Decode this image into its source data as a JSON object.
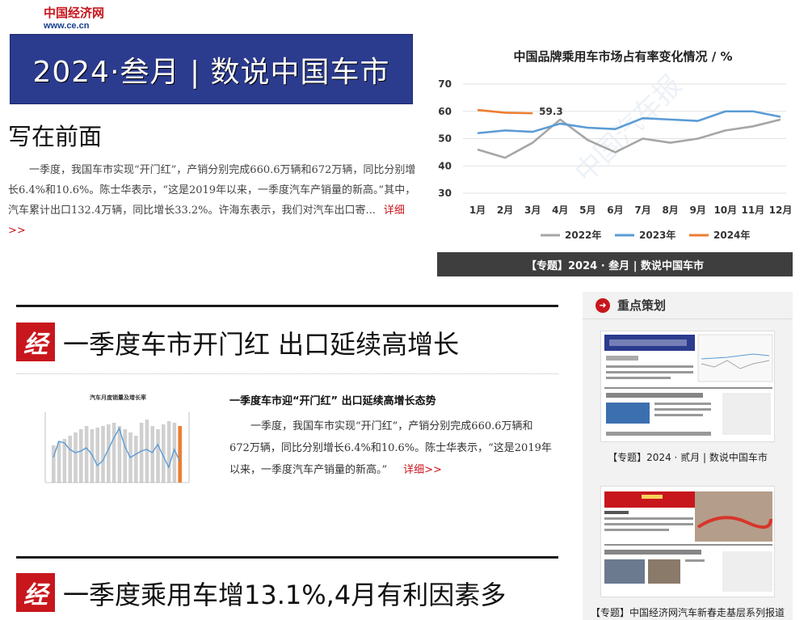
{
  "logo": {
    "cn": "中国经济网",
    "en": "www.ce.cn"
  },
  "banner": {
    "text": "2024·叁月 | 数说中国车市"
  },
  "intro": {
    "heading": "写在前面",
    "body": "一季度，我国车市实现“开门红”，产销分别完成660.6万辆和672万辆，同比分别增长6.4%和10.6%。陈士华表示，“这是2019年以来，一季度汽车产销量的新高。”其中，汽车累计出口132.4万辆，同比增长33.2%。许海东表示，我们对汽车出口寄...",
    "more": "详细>>"
  },
  "chart_data": {
    "type": "line",
    "title": "中国品牌乘用车市场占有率变化情况 / %",
    "categories": [
      "1月",
      "2月",
      "3月",
      "4月",
      "5月",
      "6月",
      "7月",
      "8月",
      "9月",
      "10月",
      "11月",
      "12月"
    ],
    "ylim": [
      30,
      70
    ],
    "yticks": [
      30,
      40,
      50,
      60,
      70
    ],
    "series": [
      {
        "name": "2022年",
        "color": "#a6a6a6",
        "values": [
          46,
          43,
          48.5,
          57,
          49.5,
          45,
          50,
          48.5,
          50,
          53,
          54.5,
          57
        ]
      },
      {
        "name": "2023年",
        "color": "#5b9bd5",
        "values": [
          52,
          53,
          52.5,
          55.5,
          54,
          53.5,
          57.5,
          57,
          56.5,
          60,
          60,
          58
        ]
      },
      {
        "name": "2024年",
        "color": "#ed7d31",
        "values": [
          60.5,
          59.5,
          59.3
        ]
      }
    ],
    "annotation": {
      "label": "59.3",
      "series": 2,
      "index": 2
    },
    "grid": true,
    "legend": "bottom"
  },
  "chart_caption": "【专题】2024 · 叁月 | 数说中国车市",
  "sections": [
    {
      "badge": "经",
      "title": "一季度车市开门红 出口延续高增长"
    },
    {
      "badge": "经",
      "title": "一季度乘用车增13.1%,4月有利因素多"
    }
  ],
  "article": {
    "title": "一季度车市迎“开门红” 出口延续高增长态势",
    "body": "一季度，我国车市实现“开门红”，产销分别完成660.6万辆和672万辆，同比分别增长6.4%和10.6%。陈士华表示，“这是2019年以来，一季度汽车产销量的新高。”",
    "more": "详细>>"
  },
  "thumb": {
    "title": "汽车月度销量及增长率"
  },
  "sidebar": {
    "heading": "重点策划",
    "cards": [
      {
        "caption": "【专题】2024 · 贰月 | 数说中国车市"
      },
      {
        "caption": "【专题】中国经济网汽车新春走基层系列报道"
      }
    ]
  }
}
